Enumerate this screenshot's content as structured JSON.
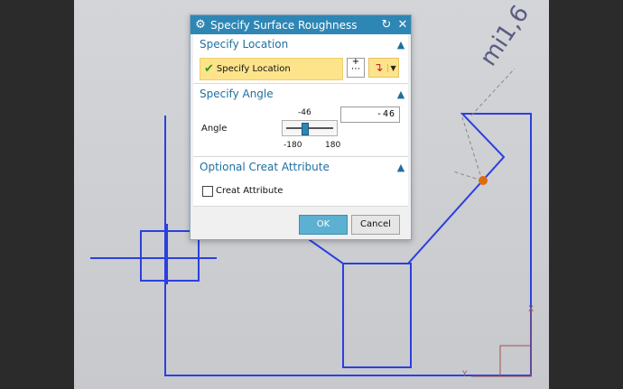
{
  "dialog": {
    "title": "Specify Surface Roughness",
    "icons": {
      "window": "gear-icon",
      "reset": "reset-icon",
      "close": "close-icon"
    }
  },
  "location_section": {
    "header": "Specify Location",
    "selection_label": "Specify Location",
    "icons": {
      "check": "checkmark-icon",
      "point": "point-constructor-icon",
      "dropdown": "arrow-dropdown-icon"
    }
  },
  "angle_section": {
    "header": "Specify Angle",
    "label": "Angle",
    "value": "-46",
    "slider": {
      "value": -46,
      "min": -180,
      "max": 180,
      "min_label": "-180",
      "max_label": "180"
    }
  },
  "attribute_section": {
    "header": "Optional Creat Attribute",
    "checkbox_label": "Creat Attribute",
    "checked": false
  },
  "buttons": {
    "ok": "OK",
    "cancel": "Cancel"
  },
  "canvas": {
    "roughness_symbol_text": "mi1,6",
    "axis_y_label": "Y",
    "axis_x_label": "X",
    "colors": {
      "geometry": "#2c3fe0",
      "point": "#e06a10",
      "background": "#cfd1d4"
    }
  }
}
